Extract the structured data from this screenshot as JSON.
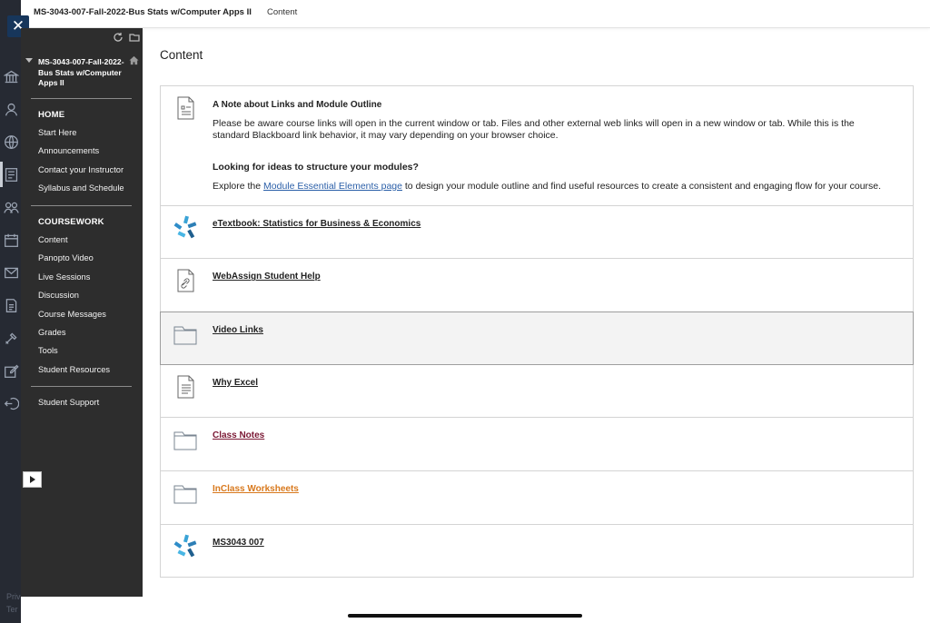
{
  "header": {
    "course_name": "MS-3043-007-Fall-2022-Bus Stats w/Computer Apps II",
    "breadcrumb": "Content"
  },
  "rail": {
    "footer_line1": "Priv",
    "footer_line2": "Ter"
  },
  "course_menu": {
    "title": "MS-3043-007-Fall-2022-Bus Stats w/Computer Apps II",
    "sections": [
      {
        "heading": "HOME",
        "items": [
          "Start Here",
          "Announcements",
          "Contact your Instructor",
          "Syllabus and Schedule"
        ]
      },
      {
        "heading": "COURSEWORK",
        "items": [
          "Content",
          "Panopto Video",
          "Live Sessions",
          "Discussion",
          "Course Messages",
          "Grades",
          "Tools",
          "Student Resources"
        ]
      }
    ],
    "extra_items": [
      "Student Support"
    ]
  },
  "main": {
    "title": "Content",
    "items": [
      {
        "title": "A Note about Links and Module Outline",
        "icon": "document-icon",
        "paragraph1": "Please be aware course links will open in the current window or tab. Files and other external web links will open in a new window or tab. While this is the standard Blackboard link behavior, it may vary depending on your browser choice.",
        "subheading": "Looking for ideas to structure your modules?",
        "p2_before": "Explore the",
        "p2_link": "Module Essential Elements page",
        "p2_after": "to design your module outline and find useful resources to create a consistent and engaging flow for your course."
      },
      {
        "title": "eTextbook: Statistics for Business & Economics",
        "icon": "tool-pinwheel-icon"
      },
      {
        "title": "WebAssign Student Help",
        "icon": "weblink-icon"
      },
      {
        "title": "Video Links",
        "icon": "folder-icon"
      },
      {
        "title": "Why Excel",
        "icon": "file-icon"
      },
      {
        "title": "Class Notes",
        "icon": "folder-icon"
      },
      {
        "title": "InClass Worksheets",
        "icon": "folder-icon"
      },
      {
        "title": "MS3043 007",
        "icon": "tool-pinwheel-icon"
      }
    ]
  },
  "colors": {
    "rail_bg": "#262a33",
    "menu_bg": "#2d2d2d",
    "close_bg": "#17365b",
    "link_blue": "#2b5fa8",
    "visited_maroon": "#7a1733",
    "hover_orange": "#d8781c"
  }
}
